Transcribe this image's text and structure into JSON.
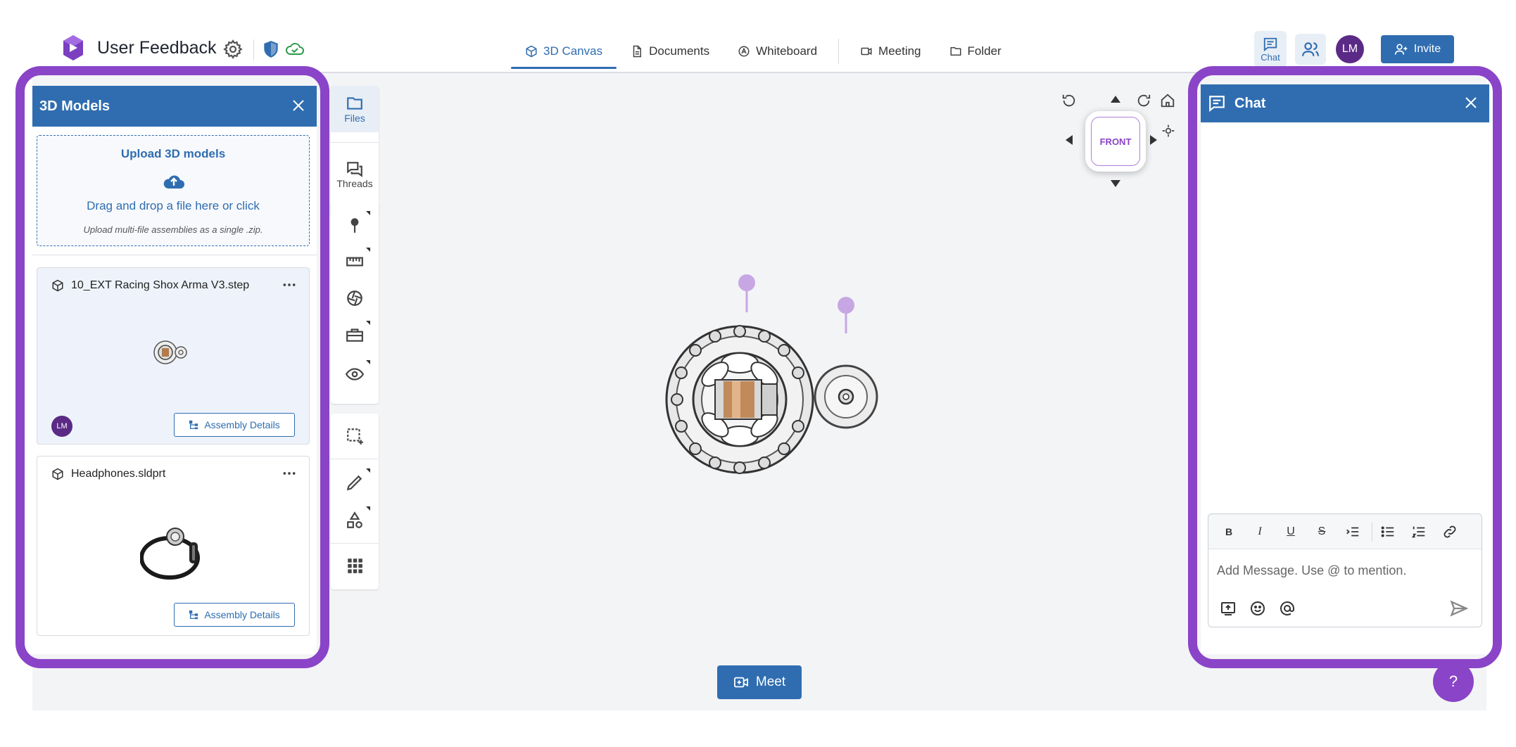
{
  "app": {
    "title": "User Feedback"
  },
  "tabs": [
    {
      "label": "3D Canvas",
      "icon": "cube-icon",
      "active": true
    },
    {
      "label": "Documents",
      "icon": "document-icon",
      "active": false
    },
    {
      "label": "Whiteboard",
      "icon": "whiteboard-icon",
      "active": false
    },
    {
      "label": "Meeting",
      "icon": "video-icon",
      "active": false
    },
    {
      "label": "Folder",
      "icon": "folder-icon",
      "active": false
    }
  ],
  "header_right": {
    "chat_label": "Chat",
    "avatar_initials": "LM",
    "invite_label": "Invite"
  },
  "models_panel": {
    "title": "3D Models",
    "upload": {
      "title": "Upload 3D models",
      "drag_text": "Drag and drop a file here or click",
      "hint": "Upload multi-file assemblies as a single .zip."
    },
    "items": [
      {
        "name": "10_EXT Racing Shox Arma V3.step",
        "owner_initials": "LM",
        "button": "Assembly Details",
        "selected": true
      },
      {
        "name": "Headphones.sldprt",
        "owner_initials": "",
        "button": "Assembly Details",
        "selected": false
      }
    ]
  },
  "toolbar": {
    "files_label": "Files",
    "threads_label": "Threads"
  },
  "navcube": {
    "face_label": "FRONT"
  },
  "meet_label": "Meet",
  "help_label": "?",
  "chat_panel": {
    "title": "Chat",
    "placeholder": "Add Message. Use @ to mention."
  },
  "colors": {
    "brand_blue": "#2f6db0",
    "highlight_purple": "#8a44c8",
    "avatar_purple": "#5b2a86"
  }
}
